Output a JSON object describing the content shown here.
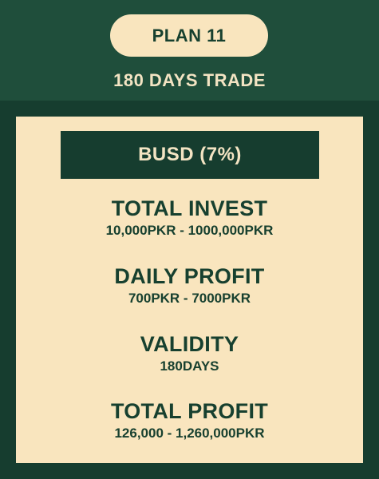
{
  "header": {
    "plan_label": "PLAN 11",
    "duration": "180 DAYS TRADE"
  },
  "card": {
    "coin": "BUSD (7%)",
    "stats": [
      {
        "label": "TOTAL INVEST",
        "value": "10,000PKR - 1000,000PKR"
      },
      {
        "label": "DAILY PROFIT",
        "value": "700PKR - 7000PKR"
      },
      {
        "label": "VALIDITY",
        "value": "180DAYS"
      },
      {
        "label": "TOTAL PROFIT",
        "value": "126,000 - 1,260,000PKR"
      }
    ]
  },
  "colors": {
    "background": "#163d2f",
    "header_band": "#1f4e3b",
    "card": "#f9e5be",
    "text_dark": "#17402f",
    "text_light": "#f3e4c3"
  }
}
